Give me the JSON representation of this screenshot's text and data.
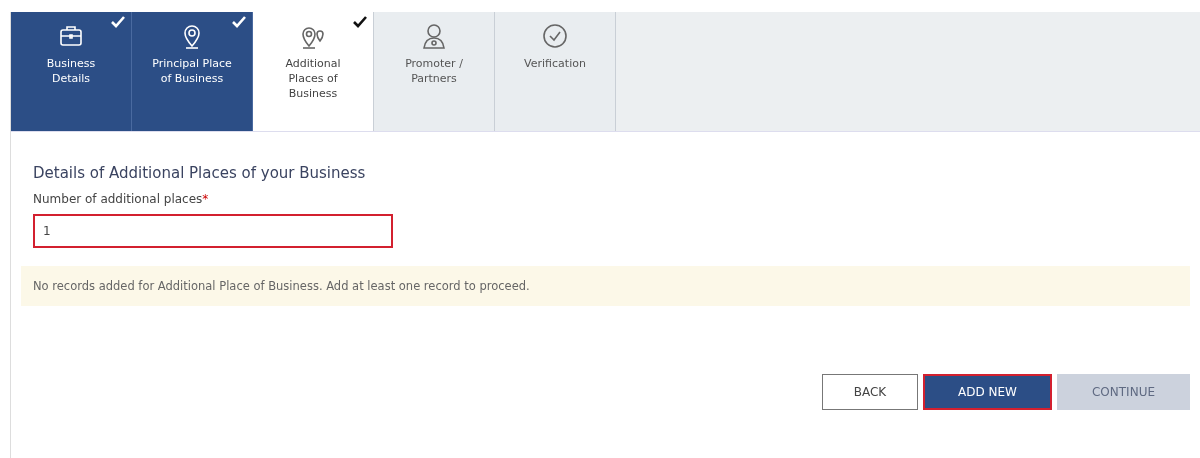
{
  "steps": [
    {
      "label": "Business Details",
      "checked": true,
      "selected": false
    },
    {
      "label": "Principal Place of Business",
      "checked": true,
      "selected": false
    },
    {
      "label": "Additional Places of Business",
      "checked": true,
      "selected": true
    },
    {
      "label": "Promoter / Partners",
      "checked": false,
      "selected": false
    },
    {
      "label": "Verification",
      "checked": false,
      "selected": false
    }
  ],
  "form": {
    "heading": "Details of Additional Places of your Business",
    "field_label": "Number of additional places",
    "required_mark": "*",
    "value": "1",
    "highlighted": true
  },
  "notice": "No records added for Additional Place of Business. Add at least one record to proceed.",
  "buttons": [
    {
      "label": "BACK",
      "kind": "outline",
      "disabled": false,
      "highlighted": false
    },
    {
      "label": "ADD NEW",
      "kind": "primary",
      "disabled": false,
      "highlighted": true
    },
    {
      "label": "CONTINUE",
      "kind": "primary",
      "disabled": true,
      "highlighted": false
    }
  ]
}
